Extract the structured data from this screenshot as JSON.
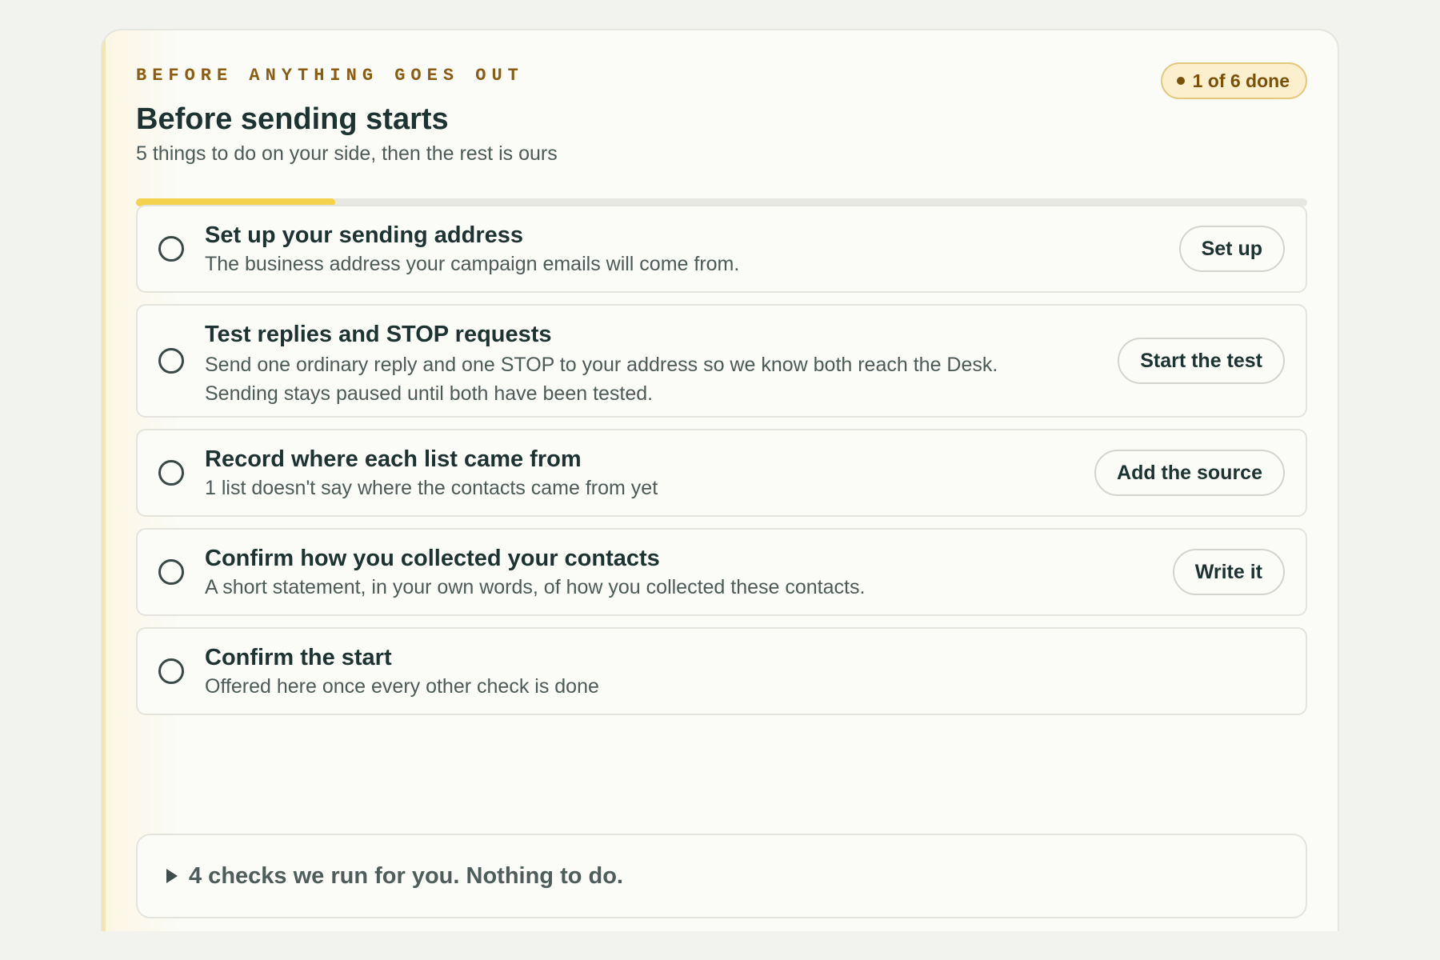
{
  "header": {
    "eyebrow": "BEFORE ANYTHING GOES OUT",
    "title": "Before sending starts",
    "subtitle": "5 things to do on your side, then the rest is ours",
    "badge": "1 of 6 done"
  },
  "progress": {
    "fraction": 0.17
  },
  "tasks": [
    {
      "title": "Set up your sending address",
      "desc1": "The business address your campaign emails will come from.",
      "desc2": "",
      "button": "Set up"
    },
    {
      "title": "Test replies and STOP requests",
      "desc1": "Send one ordinary reply and one STOP to your address so we know both reach the Desk.",
      "desc2": "Sending stays paused until both have been tested.",
      "button": "Start the test"
    },
    {
      "title": "Record where each list came from",
      "desc1": "1 list doesn't say where the contacts came from yet",
      "desc2": "",
      "button": "Add the source"
    },
    {
      "title": "Confirm how you collected your contacts",
      "desc1": "A short statement, in your own words, of how you collected these contacts.",
      "desc2": "",
      "button": "Write it"
    },
    {
      "title": "Confirm the start",
      "desc1": "Offered here once every other check is done",
      "desc2": "",
      "button": ""
    }
  ],
  "checks": {
    "label": "4 checks we run for you. Nothing to do."
  },
  "colors": {
    "accent_yellow": "#f5d24e",
    "badge_text": "#7a5108",
    "eyebrow": "#8a5d12",
    "heading": "#1c3332"
  },
  "icons": {
    "task_status": "empty-circle-icon",
    "disclosure": "triangle-right-icon"
  }
}
